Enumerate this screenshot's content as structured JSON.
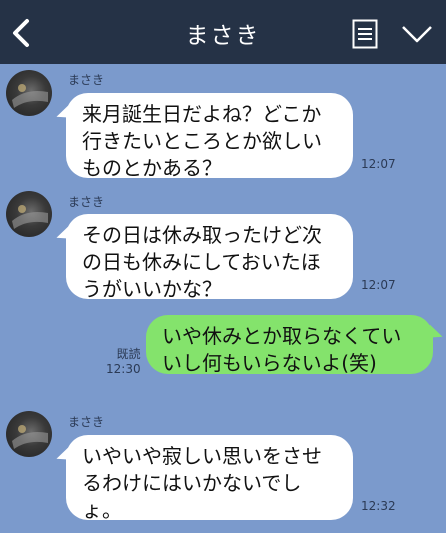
{
  "header": {
    "title": "まさき",
    "back_icon": "chevron-left-icon",
    "memo_icon": "note-icon",
    "menu_icon": "chevron-down-icon"
  },
  "messages": [
    {
      "sender": "まさき",
      "text": "来月誕生日だよね？どこか行きたいところとか欲しいものとかある？",
      "time": "12:07"
    },
    {
      "sender": "まさき",
      "text": "その日は休み取ったけど次の日も休みにしておいたほうがいいかな？",
      "time": "12:07"
    },
    {
      "text": "いや休みとか取らなくていいし何もいらないよ(笑)",
      "read": "既読",
      "time": "12:30"
    },
    {
      "sender": "まさき",
      "text": "いやいや寂しい思いをさせるわけにはいかないでしょ。",
      "time": "12:32"
    }
  ],
  "colors": {
    "header_bg": "#253246",
    "chat_bg": "#7b9acc",
    "incoming_bubble": "#ffffff",
    "outgoing_bubble": "#84e36c"
  }
}
